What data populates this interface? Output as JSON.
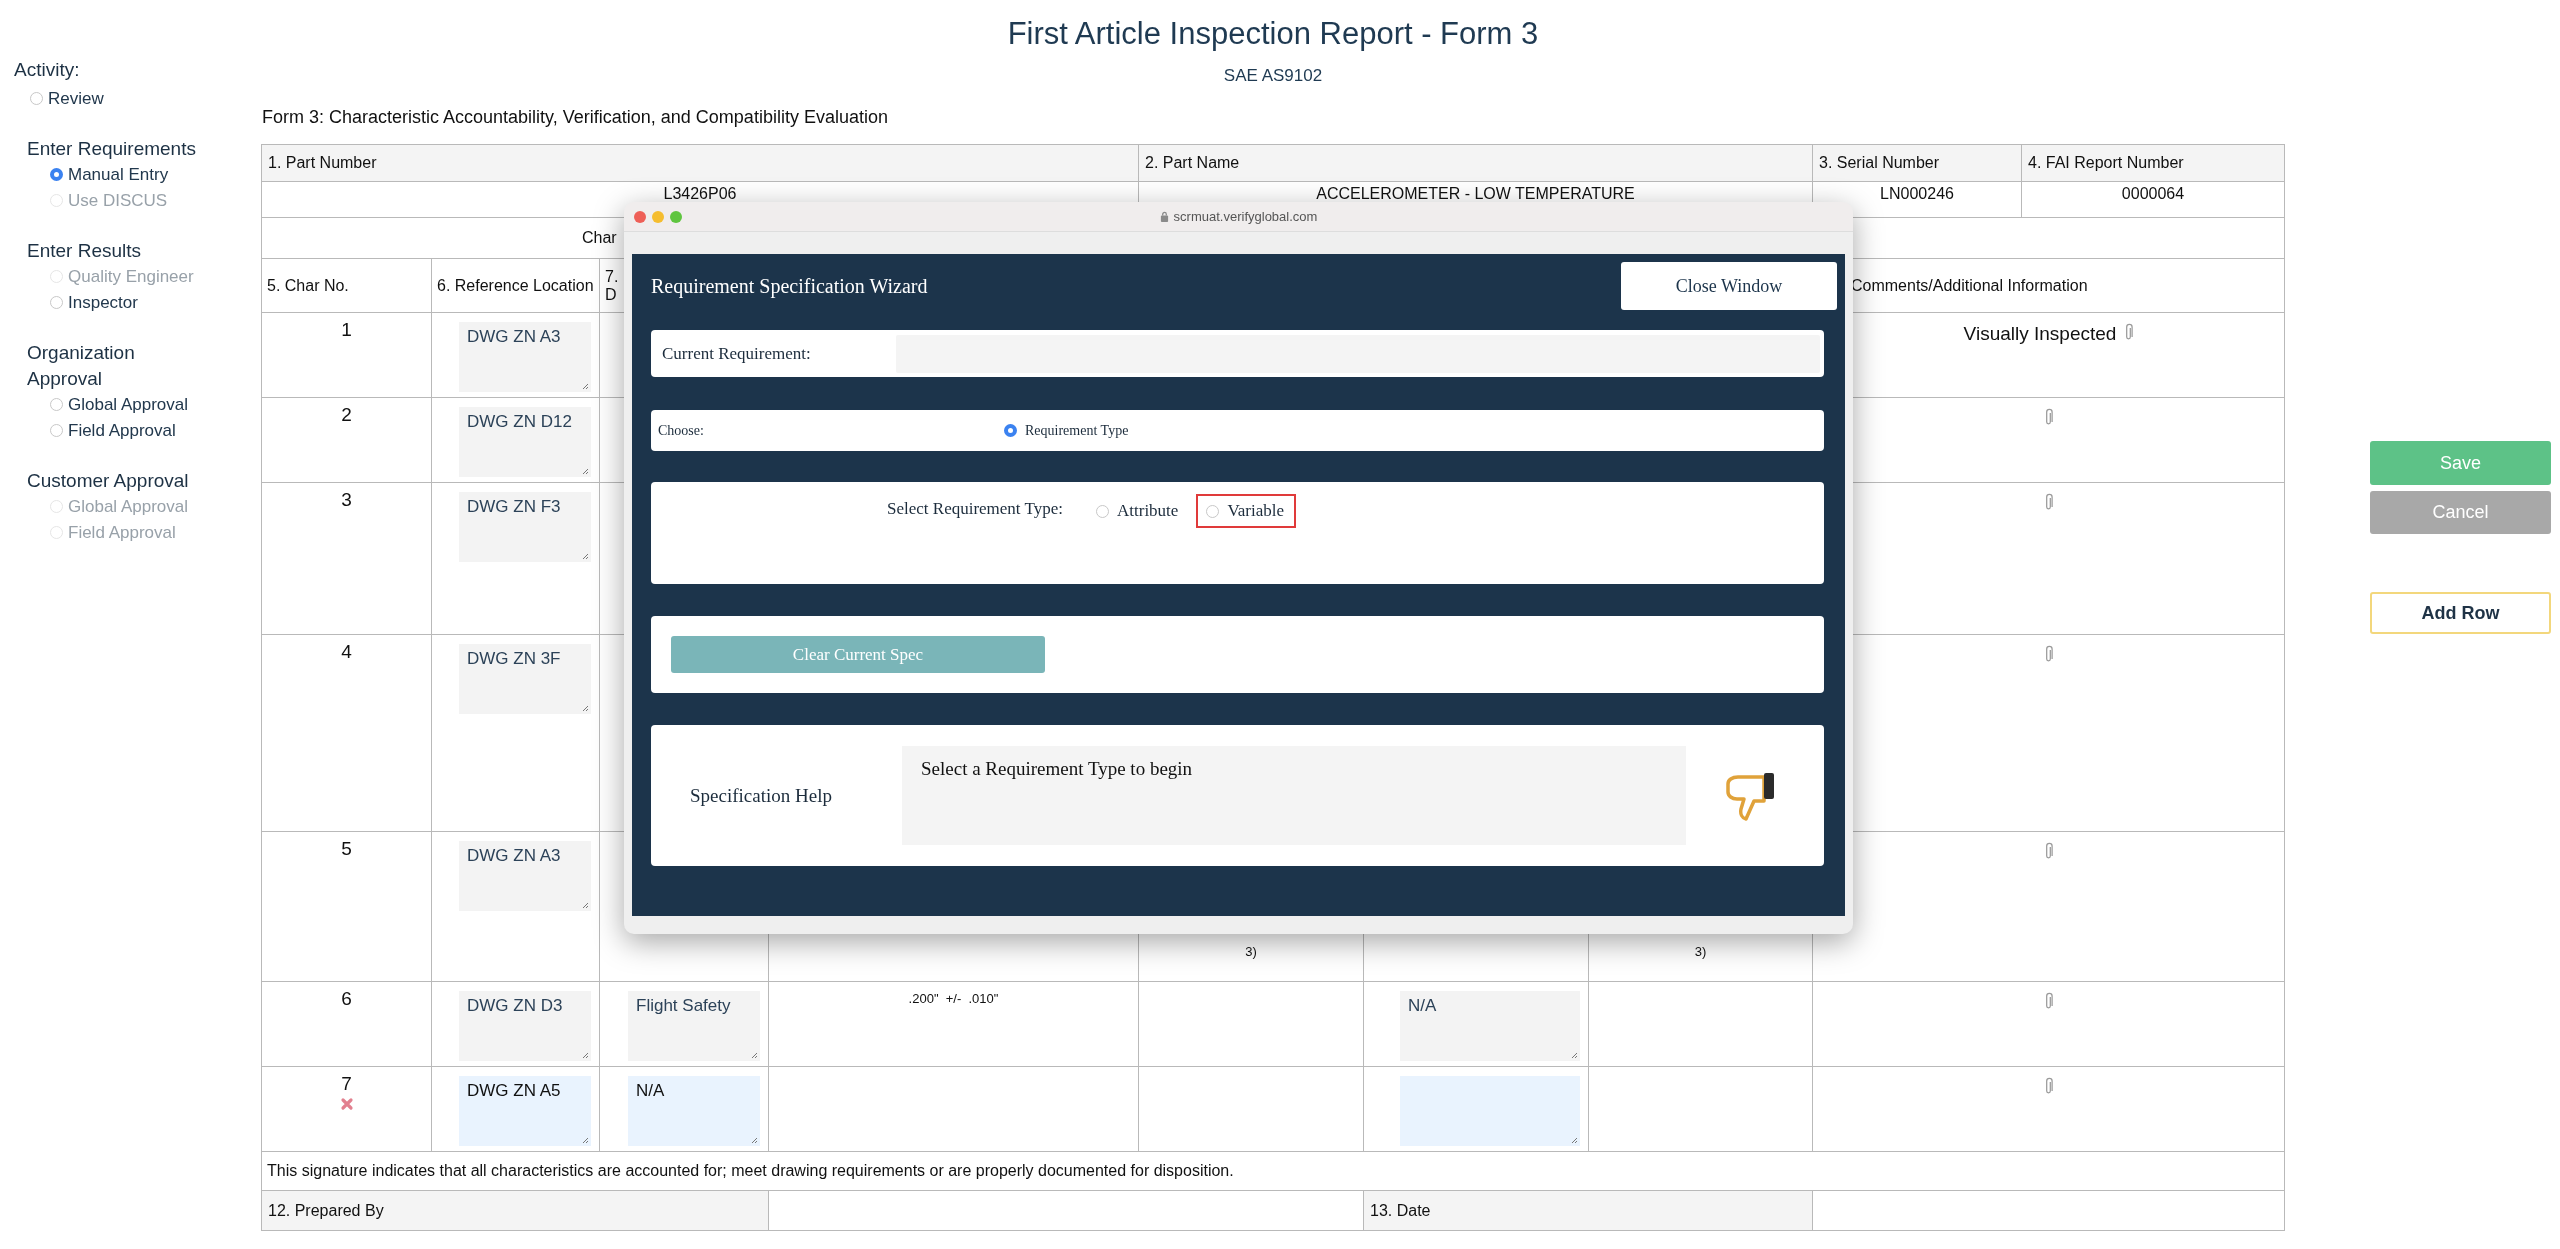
{
  "sidebar": {
    "title": "Activity:",
    "items": [
      {
        "label": "Review",
        "selected": false,
        "disabled": false
      }
    ],
    "groups": [
      {
        "heading": "Enter Requirements",
        "options": [
          {
            "label": "Manual Entry",
            "selected": true,
            "disabled": false
          },
          {
            "label": "Use DISCUS",
            "selected": false,
            "disabled": true
          }
        ]
      },
      {
        "heading": "Enter Results",
        "options": [
          {
            "label": "Quality Engineer",
            "selected": false,
            "disabled": true
          },
          {
            "label": "Inspector",
            "selected": false,
            "disabled": false
          }
        ]
      },
      {
        "heading": "Organization Approval",
        "options": [
          {
            "label": "Global Approval",
            "selected": false,
            "disabled": false
          },
          {
            "label": "Field Approval",
            "selected": false,
            "disabled": false
          }
        ]
      },
      {
        "heading": "Customer Approval",
        "options": [
          {
            "label": "Global Approval",
            "selected": false,
            "disabled": true
          },
          {
            "label": "Field Approval",
            "selected": false,
            "disabled": true
          }
        ]
      }
    ]
  },
  "page": {
    "title": "First Article Inspection Report - Form 3",
    "subtitle": "SAE AS9102",
    "form_heading": "Form 3: Characteristic Accountability, Verification, and Compatibility Evaluation"
  },
  "table": {
    "info_labels": [
      "1. Part Number",
      "2. Part Name",
      "3. Serial Number",
      "4. FAI Report Number"
    ],
    "info_values": [
      "L3426P06",
      "ACCELEROMETER - LOW TEMPERATURE",
      "LN000246",
      "0000064"
    ],
    "section_heading": "Char",
    "columns": [
      "5. Char No.",
      "6. Reference Location",
      "7. D"
    ],
    "comments_column": "Comments/Additional Information",
    "rows": [
      {
        "kind": "saved",
        "char_no": "1",
        "reference": "DWG ZN A3",
        "comment": "Visually Inspected"
      },
      {
        "kind": "saved",
        "char_no": "2",
        "reference": "DWG ZN D12"
      },
      {
        "kind": "saved",
        "char_no": "3",
        "reference": "DWG ZN F3"
      },
      {
        "kind": "saved",
        "char_no": "4",
        "reference": "DWG ZN 3F"
      },
      {
        "kind": "saved",
        "char_no": "5",
        "reference": "DWG ZN A3",
        "column_5": "3)",
        "column_7": "3)"
      },
      {
        "kind": "saved",
        "char_no": "6",
        "reference": "DWG ZN D3",
        "designator": "Flight Safety",
        "column_4": ".200\"  +/-  .010\"",
        "column_6_field": true,
        "column_6": "N/A"
      },
      {
        "kind": "new",
        "char_no": "7",
        "reference": "DWG ZN A5",
        "designator": "N/A",
        "column_6_field": true
      }
    ],
    "signature_note": "This signature indicates that all characteristics are accounted for; meet drawing requirements or are properly documented for disposition.",
    "prepared_by_label": "12. Prepared By",
    "date_label": "13. Date"
  },
  "actions": [
    {
      "label": "Save",
      "kind": "save"
    },
    {
      "label": "Cancel",
      "kind": "cancel"
    },
    {
      "label": "Add Row",
      "kind": "add"
    }
  ],
  "popup": {
    "url": "scrmuat.verifyglobal.com",
    "title": "Requirement Specification Wizard",
    "close_button": "Close Window",
    "current_requirement": {
      "label": "Current Requirement:"
    },
    "choose": {
      "label": "Choose:",
      "options": [
        {
          "label": "Requirement Type",
          "selected": true
        }
      ]
    },
    "requirement_type": {
      "label": "Select Requirement Type:",
      "options": [
        {
          "label": "Attribute",
          "selected": false,
          "highlighted": false
        },
        {
          "label": "Variable",
          "selected": false,
          "highlighted": true
        }
      ]
    },
    "clear_button": "Clear Current Spec",
    "help": {
      "label": "Specification Help",
      "text": "Select a Requirement Type to begin"
    }
  }
}
